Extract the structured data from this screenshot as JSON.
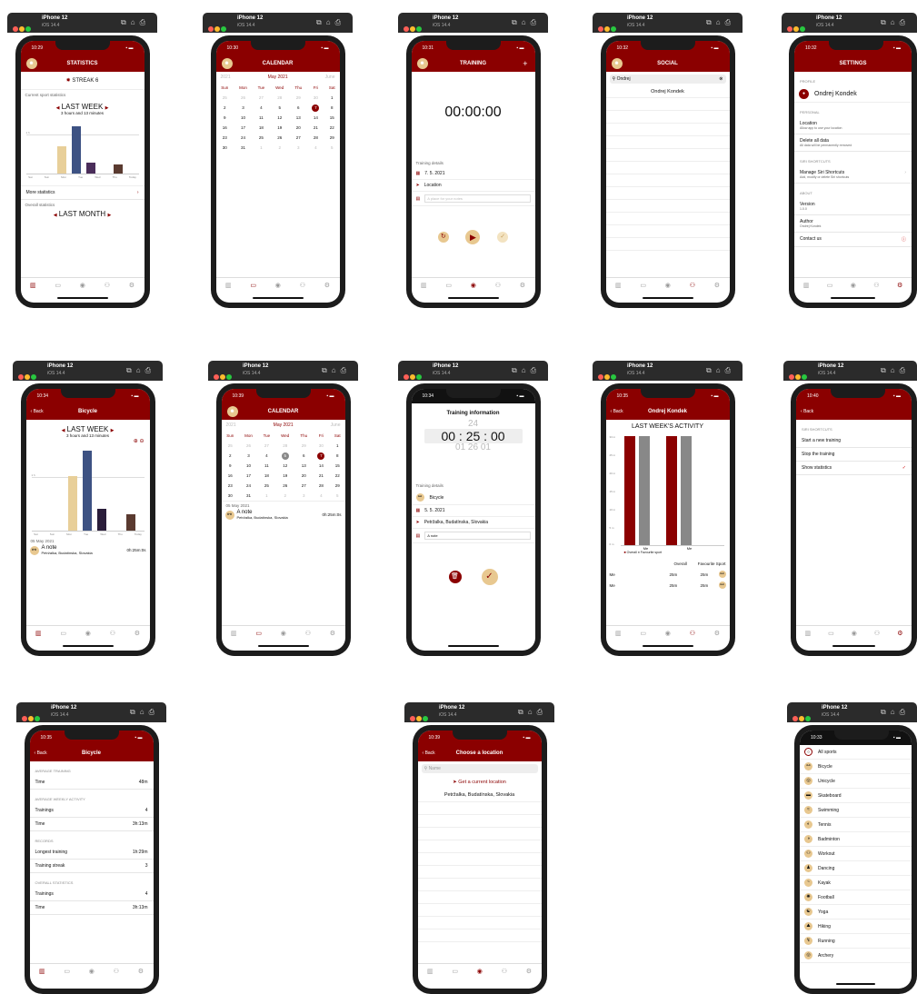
{
  "device": {
    "name": "iPhone 12",
    "os": "iOS 14.4"
  },
  "brand_color": "#8b0000",
  "tabs": [
    "chart-icon",
    "calendar-icon",
    "record-icon",
    "people-icon",
    "gear-icon"
  ],
  "statistics": {
    "time": "10:29",
    "title": "STATISTICS",
    "streak": "STREAK 6",
    "current_label": "Current sport statistics",
    "period": "LAST WEEK",
    "duration": "3 hours and 13 minutes",
    "days": [
      "Sat",
      "Sun",
      "Mon",
      "Tue",
      "Wed",
      "Thu",
      "Today"
    ],
    "y_label": "1 h",
    "more": "More statistics",
    "overall_label": "Overall statistics",
    "next_period": "LAST MONTH"
  },
  "calendar": {
    "time": "10:30",
    "title": "CALENDAR",
    "month": "May 2021",
    "prev": "2021",
    "next": "June",
    "weekdays": [
      "Sun",
      "Mon",
      "Tue",
      "Wed",
      "Thu",
      "Fri",
      "Sat"
    ],
    "weeks": [
      [
        "25",
        "26",
        "27",
        "28",
        "29",
        "30",
        "1"
      ],
      [
        "2",
        "3",
        "4",
        "5",
        "6",
        "7",
        "8"
      ],
      [
        "9",
        "10",
        "11",
        "12",
        "13",
        "14",
        "15"
      ],
      [
        "16",
        "17",
        "18",
        "19",
        "20",
        "21",
        "22"
      ],
      [
        "23",
        "24",
        "25",
        "26",
        "27",
        "28",
        "29"
      ],
      [
        "30",
        "31",
        "1",
        "2",
        "3",
        "4",
        "5"
      ]
    ]
  },
  "training": {
    "time": "10:31",
    "title": "TRAINING",
    "plus": "+",
    "timer": "00:00:00",
    "details": "Training details",
    "date": "7. 5. 2021",
    "location": "Location",
    "placeholder": "A place for your notes"
  },
  "social": {
    "time": "10:32",
    "title": "SOCIAL",
    "search": "Ondrej",
    "result": "Ondrej Kondek"
  },
  "settings": {
    "time": "10:32",
    "title": "SETTINGS",
    "profile_label": "PROFILE",
    "user": "Ondrej Kondek",
    "personal_label": "PERSONAL",
    "location": "Location",
    "location_sub": "Allow app to use your location",
    "delete": "Delete all data",
    "delete_sub": "All data will be permanently removed",
    "siri_label": "SIRI SHORTCUTS",
    "siri": "Manage Siri Shortcuts",
    "siri_sub": "Add, modify or delete Siri shortcuts",
    "about_label": "ABOUT",
    "version": "Version",
    "version_val": "1.0.0",
    "author": "Author",
    "author_val": "Ondrej Kondek",
    "contact": "Contact us"
  },
  "bicycle": {
    "time": "10:34",
    "back": "Back",
    "title": "Bicycle",
    "period": "LAST WEEK",
    "duration": "3 hours and 13 minutes",
    "date": "05 May 2021",
    "note": "A note",
    "place": "Petržalka, Budatínska, Slovakia",
    "note_time": "0h:25m:0s",
    "days": [
      "Sat",
      "Sun",
      "Mon",
      "Tue",
      "Wed",
      "Thu",
      "Today"
    ],
    "y_label": "1 h"
  },
  "calendar2": {
    "time": "10:39",
    "day": "05 May 2021",
    "note": "A note",
    "place": "Petržalka, Budatínska, Slovakia",
    "note_time": "0h:25m:0s"
  },
  "training_info": {
    "time": "10:34",
    "title": "Training information",
    "picker": [
      "24",
      "00 : 25 : 00",
      "01   26   01"
    ],
    "details": "Training details",
    "sport": "Bicycle",
    "date": "5. 5. 2021",
    "place": "Petržalka, Budatínska, Slovakia",
    "note": "A note"
  },
  "social_detail": {
    "time": "10:35",
    "back": "Back",
    "title": "Ondrej Kondek",
    "heading": "LAST WEEK'S ACTIVITY",
    "y_ticks": [
      "33 m",
      "25 m",
      "20 m",
      "15 m",
      "10 m",
      "5 m",
      "0 m"
    ],
    "x_labels": [
      "Me",
      "Me"
    ],
    "legend": [
      "Overall",
      "Favourite sport"
    ],
    "col_overall": "Overall",
    "col_fav": "Favourite Sport",
    "rows": [
      {
        "name": "Me",
        "overall": "25m",
        "fav": "25m"
      },
      {
        "name": "Me",
        "overall": "25m",
        "fav": "25m"
      }
    ]
  },
  "siri": {
    "time": "10:40",
    "back": "Back",
    "label": "SIRI SHORTCUTS",
    "items": [
      "Start a new training",
      "Stop the training",
      "Show statistics"
    ],
    "check": "✓"
  },
  "bicycle_stats": {
    "time": "10:35",
    "back": "Back",
    "title": "Bicycle",
    "avg_label": "AVERAGE TRAINING",
    "time_label": "Time",
    "avg_time": "48m",
    "weekly_label": "AVERAGE WEEKLY ACTIVITY",
    "trainings": "Trainings",
    "weekly_trainings": "4",
    "weekly_time": "3h:13m",
    "records_label": "RECORDS",
    "longest": "Longest training",
    "longest_val": "1h:29m",
    "streak": "Training streak",
    "streak_val": "3",
    "overall_label": "OVERALL STATISTICS",
    "overall_trainings": "4",
    "overall_time": "3h:13m"
  },
  "location": {
    "time": "10:39",
    "back": "Back",
    "title": "Choose a location",
    "placeholder": "Name",
    "current": "Get a current location",
    "place": "Petržalka, Budatínska, Slovakia"
  },
  "sports": {
    "time": "10:33",
    "items": [
      "All sports",
      "Bicycle",
      "Unicycle",
      "Skateboard",
      "Swimming",
      "Tennis",
      "Badminton",
      "Workout",
      "Dancing",
      "Kayak",
      "Football",
      "Yoga",
      "Hiking",
      "Running",
      "Archery"
    ]
  }
}
